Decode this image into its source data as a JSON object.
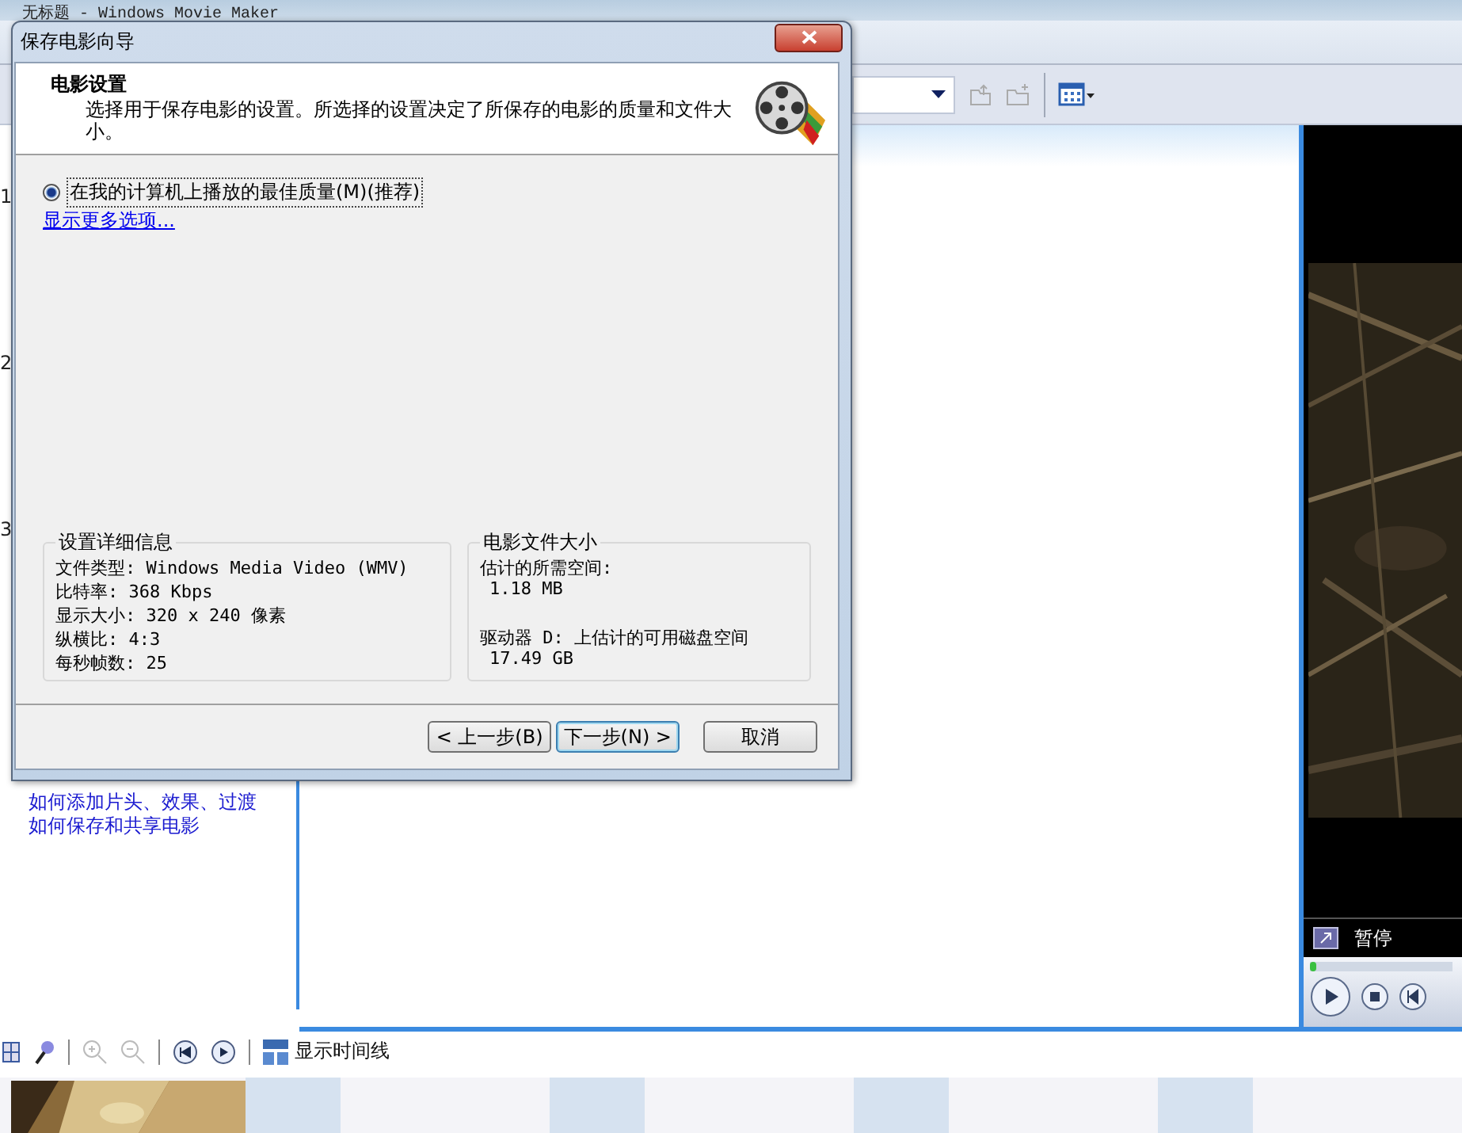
{
  "app": {
    "title": "无标题 - Windows Movie Maker"
  },
  "task_pane": {
    "step_numbers": [
      "1",
      "2",
      "3"
    ],
    "links": [
      "如何添加片头、效果、过渡",
      "如何保存和共享电影"
    ]
  },
  "monitor": {
    "status": "暂停",
    "level": 0.04
  },
  "timeline_toolbar": {
    "show_timeline": "显示时间线"
  },
  "dialog": {
    "title": "保存电影向导",
    "heading": "电影设置",
    "description": "选择用于保存电影的设置。所选择的设置决定了所保存的电影的质量和文件大小。",
    "options": [
      {
        "label": "在我的计算机上播放的最佳质量(M)(推荐)",
        "selected": true
      }
    ],
    "more_link": "显示更多选项...",
    "details": {
      "title": "设置详细信息",
      "lines": [
        "文件类型: Windows Media Video (WMV)",
        "比特率: 368 Kbps",
        "显示大小: 320 x 240 像素",
        "纵横比: 4:3",
        "每秒帧数: 25"
      ]
    },
    "file_size": {
      "title": "电影文件大小",
      "items": [
        {
          "label": "估计的所需空间:",
          "value": "1.18 MB"
        },
        {
          "label": "驱动器 D: 上估计的可用磁盘空间",
          "value": "17.49 GB"
        }
      ]
    },
    "buttons": [
      {
        "label": "< 上一步(B)",
        "kind": "back"
      },
      {
        "label": "下一步(N) >",
        "kind": "default"
      },
      {
        "label": "取消",
        "kind": "cancel"
      }
    ]
  }
}
